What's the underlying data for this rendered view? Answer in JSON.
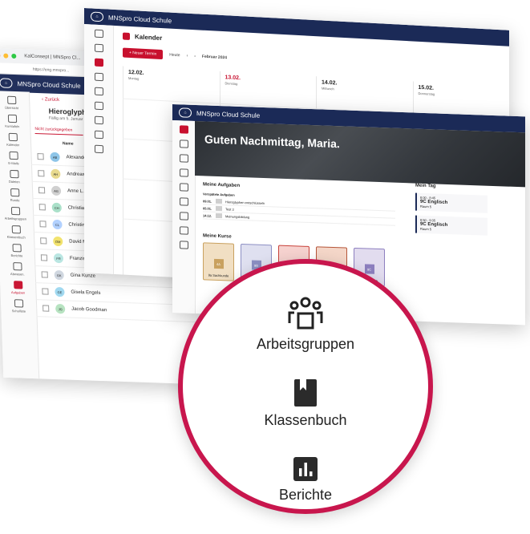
{
  "brand": "MNSpro Cloud Schule",
  "browser": {
    "tab": "KalConsept | MNSpro Cl...",
    "url": "https://eng.mnspro..."
  },
  "colors": {
    "navy": "#1b2a57",
    "accent": "#c8102e",
    "ring": "#c8164d"
  },
  "back_window": {
    "back_label": "Zurück",
    "title": "Hieroglyphen",
    "subtitle": "Fällig am 5. Januar",
    "tab": "Nicht zurückgegeben",
    "col_name": "Name",
    "rail": [
      "Übersicht",
      "Kurstafeln",
      "Kalender",
      "E-Mails",
      "Dateien",
      "Runde",
      "Arbeitsgruppen",
      "Klassenbuch",
      "Berichte",
      "Abwesen.",
      "Aufgaben",
      "Schulliste"
    ],
    "students": [
      {
        "initials": "AB",
        "name": "Alexander",
        "color": "#8bc4e8"
      },
      {
        "initials": "AH",
        "name": "Andreas",
        "color": "#e8d98b"
      },
      {
        "initials": "AG",
        "name": "Anne L.",
        "color": "#cfcfcf"
      },
      {
        "initials": "CH",
        "name": "Christian",
        "color": "#a8e0c8"
      },
      {
        "initials": "CL",
        "name": "Christina",
        "color": "#b0d0ff"
      },
      {
        "initials": "DM",
        "name": "David Michels",
        "color": "#f2e36a"
      },
      {
        "initials": "FR",
        "name": "Franziska Reichelt",
        "color": "#b8e6e2"
      },
      {
        "initials": "GK",
        "name": "Gina Kunze",
        "color": "#cfd6e0"
      },
      {
        "initials": "GE",
        "name": "Gisela Engels",
        "color": "#9ed8f0"
      },
      {
        "initials": "JG",
        "name": "Jacob Goodman",
        "color": "#b5e3c0"
      }
    ]
  },
  "calendar": {
    "title": "Kalender",
    "new_button": "+ Neuer Termin",
    "today": "Heute",
    "month": "Februar 2024",
    "days": [
      {
        "date": "12.02.",
        "name": "Montag"
      },
      {
        "date": "13.02.",
        "name": "Dienstag"
      },
      {
        "date": "14.02.",
        "name": "Mittwoch"
      },
      {
        "date": "15.02.",
        "name": "Donnerstag"
      }
    ]
  },
  "dashboard": {
    "greeting": "Guten Nachmittag, Maria.",
    "tasks_title": "Meine Aufgaben",
    "tasks_sub": "Verspätete Aufgaben",
    "tasks": [
      {
        "date": "09.01.",
        "label": "Hieroglyphen entschlüsseln"
      },
      {
        "date": "05.01.",
        "label": "Test 3"
      },
      {
        "date": "14.12.",
        "label": "Meinungsbildung"
      }
    ],
    "day_title": "Mein Tag",
    "day_items": [
      {
        "time": "8:00 - 8:45",
        "course": "9C Englisch",
        "room": "Raum 5"
      },
      {
        "time": "8:50 - 9:35",
        "course": "9C Englisch",
        "room": "Raum 5"
      }
    ],
    "courses_title": "Meine Kurse",
    "courses": [
      {
        "label": "9a Sachkunde",
        "icon": "4A",
        "bg": "#f1dfc3",
        "icbg": "#c9a15f"
      },
      {
        "label": "9B Englisch",
        "icon": "9B",
        "bg": "#dfe0f0",
        "icbg": "#8c8fc3"
      },
      {
        "label": "9B Erdkunde",
        "icon": "9C",
        "bg": "#f6d2cf",
        "icbg": "#c8423a"
      },
      {
        "label": "9B Geschichte",
        "icon": "9B",
        "bg": "#f4d6c8",
        "icbg": "#b5563a"
      },
      {
        "label": "9C Englisch",
        "icon": "9C",
        "bg": "#e2dcef",
        "icbg": "#8d7fbf"
      }
    ]
  },
  "zoom": {
    "items": [
      {
        "label": "Arbeitsgruppen",
        "icon": "people-group-icon"
      },
      {
        "label": "Klassenbuch",
        "icon": "book-icon"
      },
      {
        "label": "Berichte",
        "icon": "bar-chart-icon"
      }
    ]
  }
}
